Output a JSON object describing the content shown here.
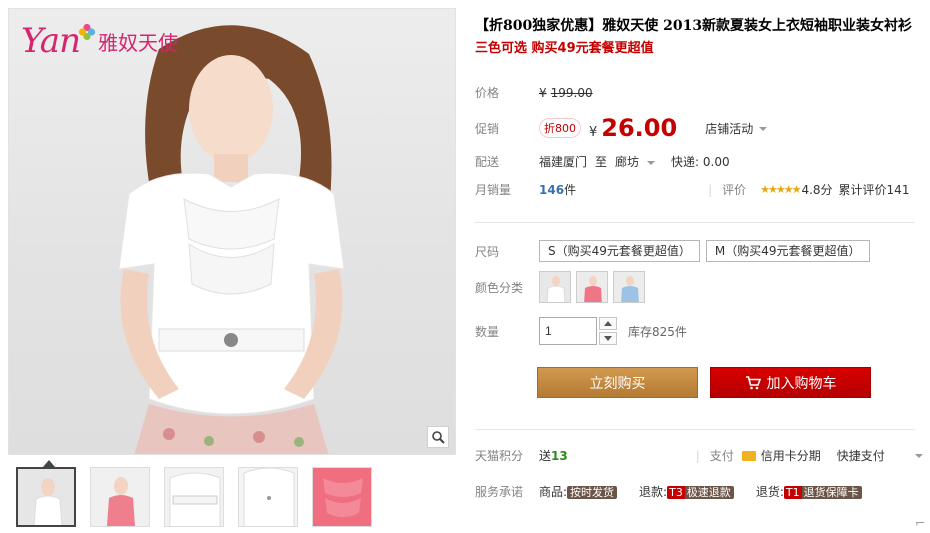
{
  "gallery": {
    "logo_text": "Yan",
    "logo_cn": "雅奴天使",
    "thumbnails": [
      "thumb-white-1",
      "thumb-pink",
      "thumb-belt",
      "thumb-white-2",
      "thumb-pink-ruffle"
    ]
  },
  "product": {
    "title": "【折800独家优惠】雅奴天使 2013新款夏装女上衣短袖职业装女衬衫",
    "subtitle": "三色可选 购买49元套餐更超值"
  },
  "price": {
    "label": "价格",
    "currency": "¥",
    "original": "199.00"
  },
  "promo": {
    "label": "促销",
    "badge": "折800",
    "currency": "¥",
    "price": "26.00",
    "shop_activity": "店铺活动"
  },
  "shipping": {
    "label": "配送",
    "from": "福建厦门",
    "to_word": "至",
    "to": "廊坊",
    "fee": "快递: 0.00"
  },
  "sales": {
    "label": "月销量",
    "count": "146",
    "unit": "件",
    "rating_label": "评价",
    "stars": "★★★★★",
    "score": "4.8分",
    "total_reviews": "累计评价141"
  },
  "size": {
    "label": "尺码",
    "options": [
      "S（购买49元套餐更超值）",
      "M（购买49元套餐更超值）"
    ]
  },
  "color": {
    "label": "颜色分类",
    "options": [
      "white",
      "pink",
      "blue"
    ]
  },
  "quantity": {
    "label": "数量",
    "value": "1",
    "stock": "库存825件"
  },
  "actions": {
    "buy_now": "立刻购买",
    "add_to_cart": "加入购物车"
  },
  "points": {
    "label": "天猫积分",
    "send_text": "送",
    "value": "13",
    "pay_label": "支付",
    "card_installment": "信用卡分期",
    "quick_pay": "快捷支付"
  },
  "service": {
    "label": "服务承诺",
    "goods_label": "商品:",
    "goods_tag": "按时发货",
    "refund_label": "退款:",
    "refund_num": "T3",
    "refund_tag": "极速退款",
    "return_label": "退货:",
    "return_num": "T1",
    "return_tag": "退货保障卡"
  },
  "colors": {
    "accent_red": "#c40000",
    "buy_button": "#c0863c",
    "cart_button": "#c40000",
    "logo_pink": "#d6246e"
  }
}
